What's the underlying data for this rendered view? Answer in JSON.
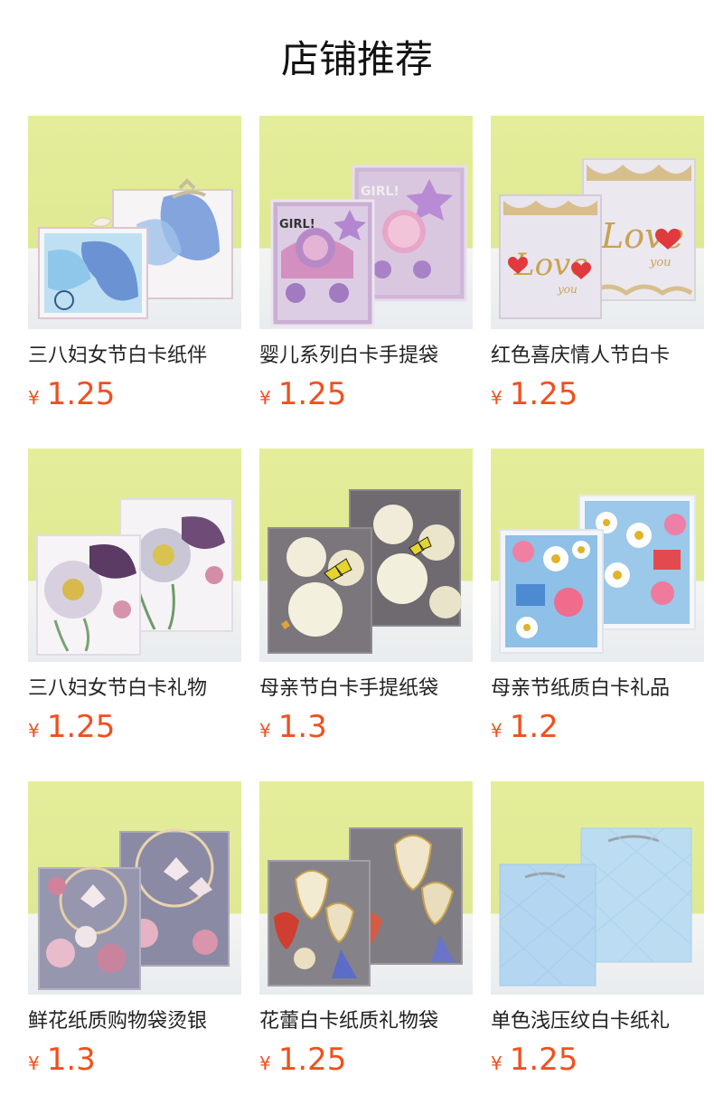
{
  "page_title": "店铺推荐",
  "currency_symbol": "¥",
  "colors": {
    "price": "#f0501e",
    "background": "#ffffff",
    "photo_backdrop": "#e1eb96"
  },
  "products": [
    {
      "name": "三八妇女节白卡纸伴",
      "price": "1.25",
      "image": "butterfly-gift-bags-blue"
    },
    {
      "name": "婴儿系列白卡手提袋",
      "price": "1.25",
      "image": "baby-girl-stroller-bags-pink"
    },
    {
      "name": "红色喜庆情人节白卡",
      "price": "1.25",
      "image": "love-gold-foil-bags"
    },
    {
      "name": "三八妇女节白卡礼物",
      "price": "1.25",
      "image": "purple-anemone-bags"
    },
    {
      "name": "母亲节白卡手提纸袋",
      "price": "1.3",
      "image": "white-rose-butterfly-bags"
    },
    {
      "name": "母亲节纸质白卡礼品",
      "price": "1.2",
      "image": "daisy-gift-box-bags"
    },
    {
      "name": "鲜花纸质购物袋烫银",
      "price": "1.3",
      "image": "pink-rose-butterfly-bags"
    },
    {
      "name": "花蕾白卡纸质礼物袋",
      "price": "1.25",
      "image": "golden-lily-bags"
    },
    {
      "name": "单色浅压纹白卡纸礼",
      "price": "1.25",
      "image": "plain-light-blue-bags"
    }
  ]
}
